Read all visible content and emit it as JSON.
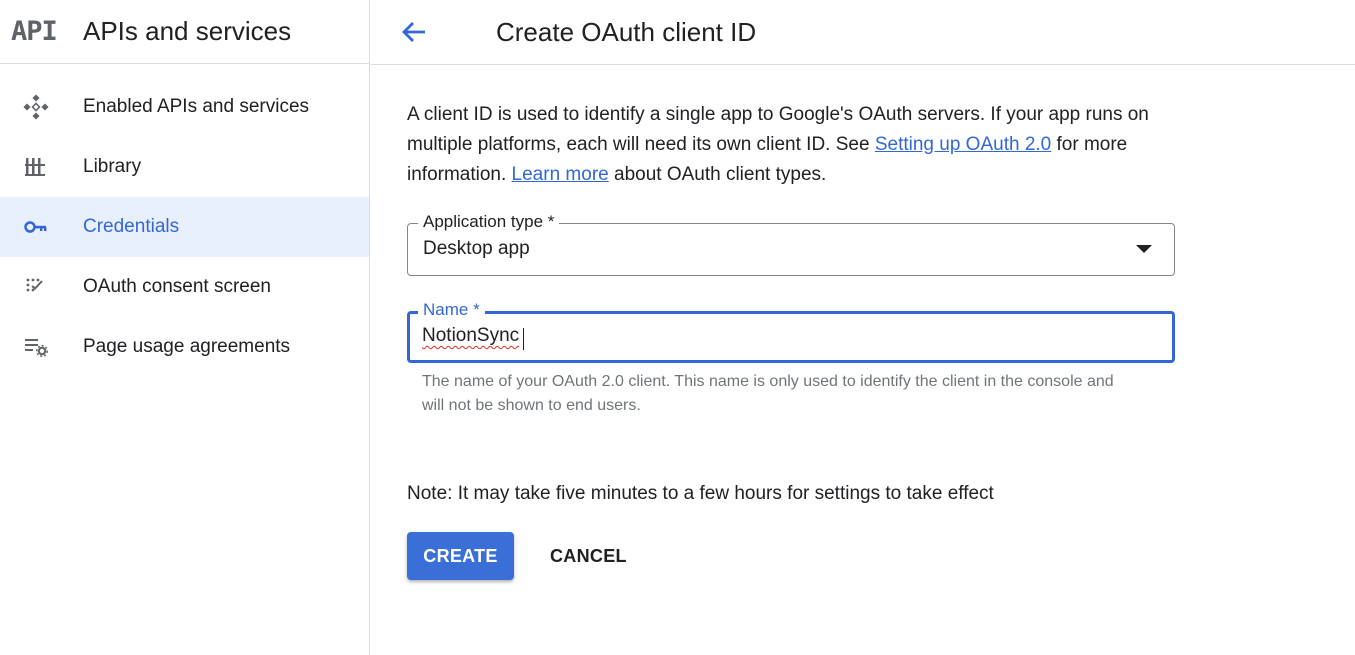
{
  "sidebar": {
    "logo": "API",
    "title": "APIs and services",
    "items": [
      {
        "label": "Enabled APIs and services",
        "icon": "enabled-apis-icon"
      },
      {
        "label": "Library",
        "icon": "library-icon"
      },
      {
        "label": "Credentials",
        "icon": "key-icon",
        "active": true
      },
      {
        "label": "OAuth consent screen",
        "icon": "consent-screen-icon"
      },
      {
        "label": "Page usage agreements",
        "icon": "settings-list-icon"
      }
    ]
  },
  "header": {
    "back_icon": "arrow-back-icon",
    "title": "Create OAuth client ID"
  },
  "main": {
    "intro_part1": "A client ID is used to identify a single app to Google's OAuth servers. If your app runs on multiple platforms, each will need its own client ID. See ",
    "intro_link1": "Setting up OAuth 2.0",
    "intro_part2": " for more information. ",
    "intro_link2": "Learn more",
    "intro_part3": " about OAuth client types.",
    "app_type": {
      "label": "Application type *",
      "value": "Desktop app"
    },
    "name": {
      "label": "Name *",
      "value": "NotionSync",
      "hint": "The name of your OAuth 2.0 client. This name is only used to identify the client in the console and will not be shown to end users."
    },
    "note": "Note: It may take five minutes to a few hours for settings to take effect",
    "create_label": "CREATE",
    "cancel_label": "CANCEL"
  },
  "colors": {
    "accent": "#3367d6",
    "active_bg": "#e8f0fe",
    "button_bg": "#3b6fd8"
  }
}
